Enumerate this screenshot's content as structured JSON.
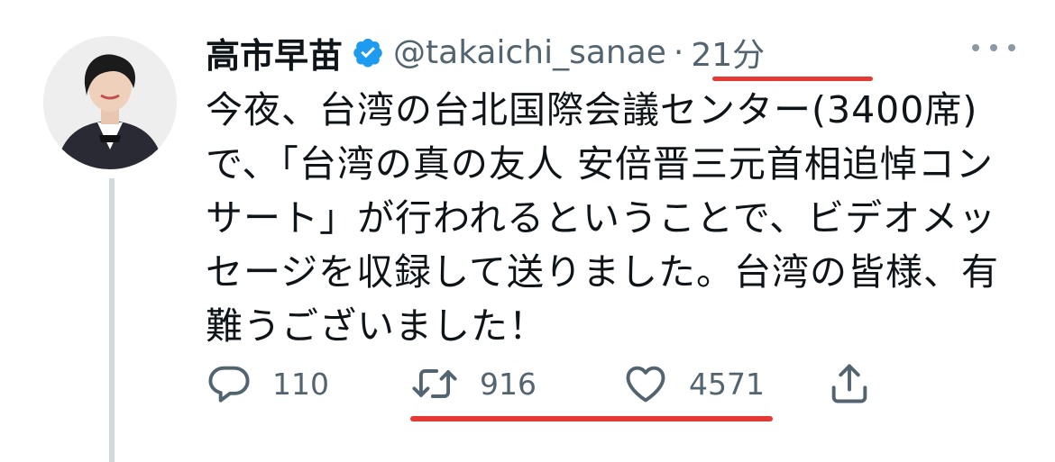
{
  "user": {
    "display_name": "高市早苗",
    "handle": "@takaichi_sanae",
    "separator": "·",
    "time": "21分"
  },
  "tweet": {
    "lines": [
      "今夜、台湾の台北国際会議センター(3400席)",
      "で、「台湾の真の友人 安倍晋三元首相追悼コン",
      "サート」が行われるということで、ビデオメッ",
      "セージを収録して送りました。台湾の皆様、有",
      "難うございました！"
    ]
  },
  "actions": {
    "reply_count": "110",
    "retweet_count": "916",
    "like_count": "4571"
  },
  "icons": {
    "verified": "verified-badge-icon",
    "more": "more-options-icon",
    "reply": "reply-icon",
    "retweet": "retweet-icon",
    "like": "heart-icon",
    "share": "share-icon"
  },
  "colors": {
    "verified_blue": "#1d9bf0",
    "text_primary": "#0f1419",
    "text_secondary": "#536471",
    "annotation_red": "#e53935",
    "thread_line": "#cfd9de"
  }
}
